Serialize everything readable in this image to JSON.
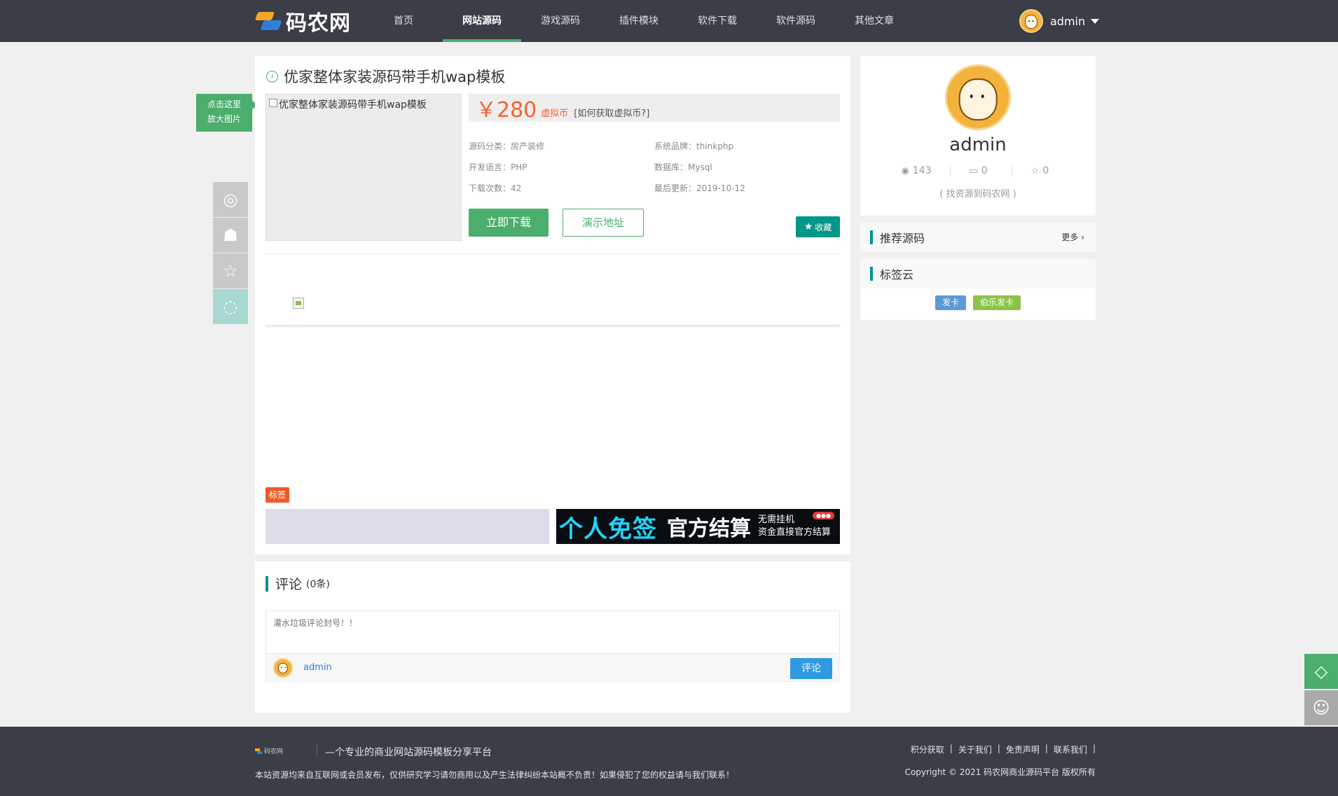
{
  "header": {
    "logo_text": "码农网",
    "nav": [
      "首页",
      "网站源码",
      "游戏源码",
      "插件模块",
      "软件下载",
      "软件源码",
      "其他文章"
    ],
    "user_name": "admin"
  },
  "product": {
    "title": "优家整体家装源码带手机wap模板",
    "image_alt": "优家整体家装源码带手机wap模板",
    "price": "￥280",
    "currency": "虚拟币",
    "how_to": "[如何获取虚拟币?]",
    "meta": {
      "category": "源码分类：房产装修",
      "brand": "系统品牌：thinkphp",
      "language": "开发语言：PHP",
      "database": "数据库：Mysql",
      "downloads": "下载次数：42",
      "updated": "最后更新：2019-10-12"
    },
    "download_label": "立即下载",
    "demo_label": "演示地址",
    "favorite_label": "收藏",
    "tag_label": "标签"
  },
  "ad": {
    "text1": "个人免签",
    "text2": "官方结算",
    "text3a": "无需挂机",
    "text3b": "资金直接官方结算"
  },
  "comments": {
    "title": "评论",
    "count": "(0条)",
    "placeholder": "灌水垃圾评论封号！！",
    "user": "admin",
    "submit_label": "评论"
  },
  "profile": {
    "name": "admin",
    "views": "143",
    "comments": "0",
    "stars": "0",
    "tagline": "( 找资源到码农网 )"
  },
  "sidebar": {
    "recommend_title": "推荐源码",
    "more_label": "更多",
    "tagcloud_title": "标签云",
    "tags": [
      {
        "label": "发卡",
        "color": "#5b9bd5"
      },
      {
        "label": "伯乐发卡",
        "color": "#8bc34a"
      }
    ]
  },
  "zoom_tip": {
    "line1": "点击这里",
    "line2": "放大图片"
  },
  "footer": {
    "logo_small": "码农网",
    "slogan": "—个专业的商业网站源码模板分享平台",
    "disclaimer": "本站资源均来自互联网或会员发布，仅供研究学习请勿商用以及产生法律纠纷本站概不负责！如果侵犯了您的权益请与我们联系！",
    "links": [
      "积分获取",
      "关于我们",
      "免责声明",
      "联系我们"
    ],
    "copyright": "Copyright © 2021 码农网商业源码平台 版权所有"
  },
  "colors": {
    "header_bg": "#3b3d47",
    "accent_green": "#4bae6d",
    "price_orange": "#f4642c",
    "teal": "#009688",
    "comment_blue": "#2f9ae0"
  }
}
